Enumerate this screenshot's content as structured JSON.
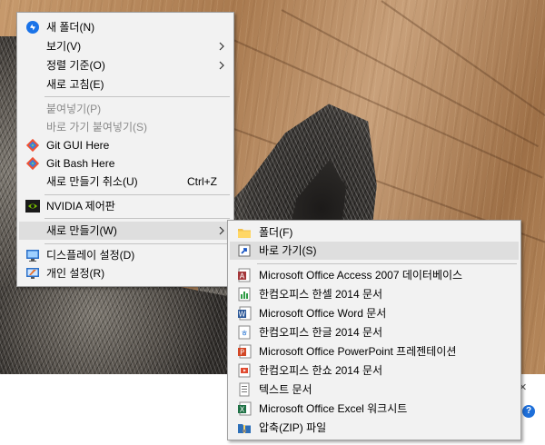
{
  "context_menu": {
    "items": [
      {
        "label": "새 폴더(N)",
        "icon": "new-folder-icon"
      },
      {
        "label": "보기(V)"
      },
      {
        "label": "정렬 기준(O)"
      },
      {
        "label": "새로 고침(E)"
      },
      {
        "label": "붙여넣기(P)",
        "disabled": true
      },
      {
        "label": "바로 가기 붙여넣기(S)",
        "disabled": true
      },
      {
        "label": "Git GUI Here",
        "icon": "git-icon"
      },
      {
        "label": "Git Bash Here",
        "icon": "git-icon"
      },
      {
        "label": "새로 만들기 취소(U)",
        "accelerator": "Ctrl+Z"
      },
      {
        "label": "NVIDIA 제어판",
        "icon": "nvidia-icon"
      },
      {
        "label": "새로 만들기(W)"
      },
      {
        "label": "디스플레이 설정(D)",
        "icon": "display-icon"
      },
      {
        "label": "개인 설정(R)",
        "icon": "personalize-icon"
      }
    ]
  },
  "new_submenu": {
    "items": [
      {
        "label": "폴더(F)",
        "icon": "folder-icon"
      },
      {
        "label": "바로 가기(S)",
        "icon": "shortcut-icon"
      },
      {
        "label": "Microsoft Office Access 2007 데이터베이스",
        "icon": "access-icon"
      },
      {
        "label": "한컴오피스 한셀 2014 문서",
        "icon": "hancell-icon"
      },
      {
        "label": "Microsoft Office Word 문서",
        "icon": "word-icon"
      },
      {
        "label": "한컴오피스 한글 2014 문서",
        "icon": "hwp-icon"
      },
      {
        "label": "Microsoft Office PowerPoint 프레젠테이션",
        "icon": "powerpoint-icon"
      },
      {
        "label": "한컴오피스 한쇼 2014 문서",
        "icon": "hanshow-icon"
      },
      {
        "label": "텍스트 문서",
        "icon": "text-document-icon"
      },
      {
        "label": "Microsoft Office Excel 워크시트",
        "icon": "excel-icon"
      },
      {
        "label": "압축(ZIP) 파일",
        "icon": "zip-icon"
      }
    ]
  },
  "colors": {
    "menu_bg": "#f2f2f2",
    "highlight": "#dedede",
    "disabled_text": "#8a8a8a",
    "help_icon": "#1e6fd9"
  }
}
